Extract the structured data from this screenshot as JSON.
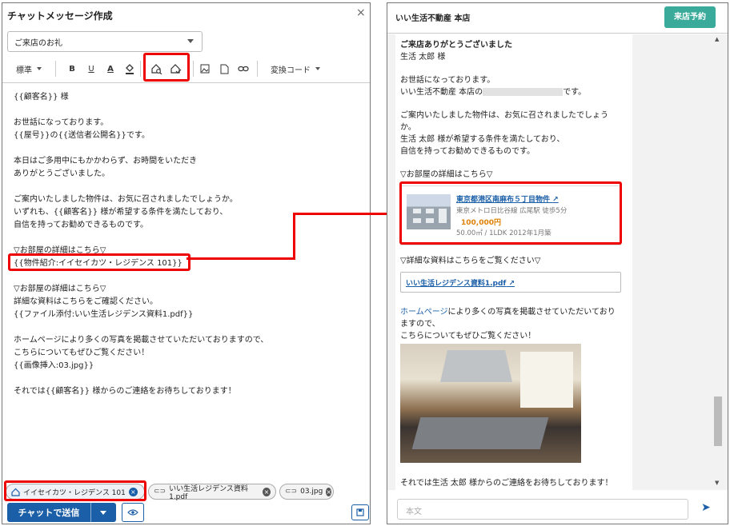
{
  "left_panel": {
    "title": "チャットメッセージ作成",
    "close_label": "×",
    "template_select": "ご来店のお礼",
    "toolbar": {
      "format": "標準",
      "bold": "B",
      "underline": "U",
      "font_color": "A",
      "convert_code": "変換コード"
    },
    "editor_lines": [
      "{{顧客名}} 様",
      "",
      "お世話になっております。",
      "{{屋号}}の{{送信者公開名}}です。",
      "",
      "本日はご多用中にもかかわらず、お時間をいただき",
      "ありがとうございました。",
      "",
      "ご案内いたしました物件は、お気に召されましたでしょうか。",
      "いずれも、{{顧客名}} 様が希望する条件を満たしており、",
      "自信を持ってお勧めできるものです。",
      "",
      "▽お部屋の詳細はこちら▽",
      "{{物件紹介:イイセイカツ・レジデンス 101}}",
      "",
      "▽お部屋の詳細はこちら▽",
      "詳細な資料はこちらをご確認ください。",
      "{{ファイル添付:いい生活レジデンス資料1.pdf}}",
      "",
      "ホームページにより多くの写真を掲載させていただいておりますので、",
      "こちらについてもぜひご覧ください！",
      "{{画像挿入:03.jpg}}",
      "",
      "それでは{{顧客名}} 様からのご連絡をお待ちしております！"
    ],
    "attachments": [
      {
        "label": "イイセイカツ・レジデンス 101",
        "icon": "house-icon"
      },
      {
        "label": "いい生活レジデンス資料1.pdf",
        "icon": "paperclip-icon"
      },
      {
        "label": "03.jpg",
        "icon": "paperclip-icon"
      }
    ],
    "send_button": "チャットで送信"
  },
  "right_panel": {
    "title": "いい生活不動産 本店",
    "visit_button": "来店予約",
    "message": {
      "heading": "ご来店ありがとうございました",
      "customer": "生活 太郎 様",
      "greeting1": "お世話になっております。",
      "greeting2_pre": "いい生活不動産 本店の",
      "greeting2_post": "です。",
      "body1": "ご案内いたしました物件は、お気に召されましたでしょう",
      "body2": "か。",
      "body3": "生活 太郎 様が希望する条件を満たしており、",
      "body4": "自信を持ってお勧めできるものです。",
      "room_detail": "▽お部屋の詳細はこちら▽",
      "property": {
        "link": "東京都港区南麻布５丁目物件",
        "access": "東京メトロ日比谷線 広尾駅 徒歩5分",
        "price": "100,000円",
        "spec": "50.00㎡ / 1LDK  2012年1月築"
      },
      "doc_heading": "▽詳細な資料はこちらをご覧ください▽",
      "doc_link": "いい生活レジデンス資料1.pdf",
      "hp_link": "ホームページ",
      "hp_text1": "により多くの写真を掲載させていただいており",
      "hp_text2": "ますので、",
      "hp_text3": "こちらについてもぜひご覧ください！",
      "closing": "それでは生活 太郎 様からのご連絡をお待ちしております！"
    },
    "input_placeholder": "本文"
  },
  "colors": {
    "highlight": "#e00000",
    "primary": "#1b5fa8",
    "teal": "#3aaa9a",
    "price": "#e08000"
  }
}
